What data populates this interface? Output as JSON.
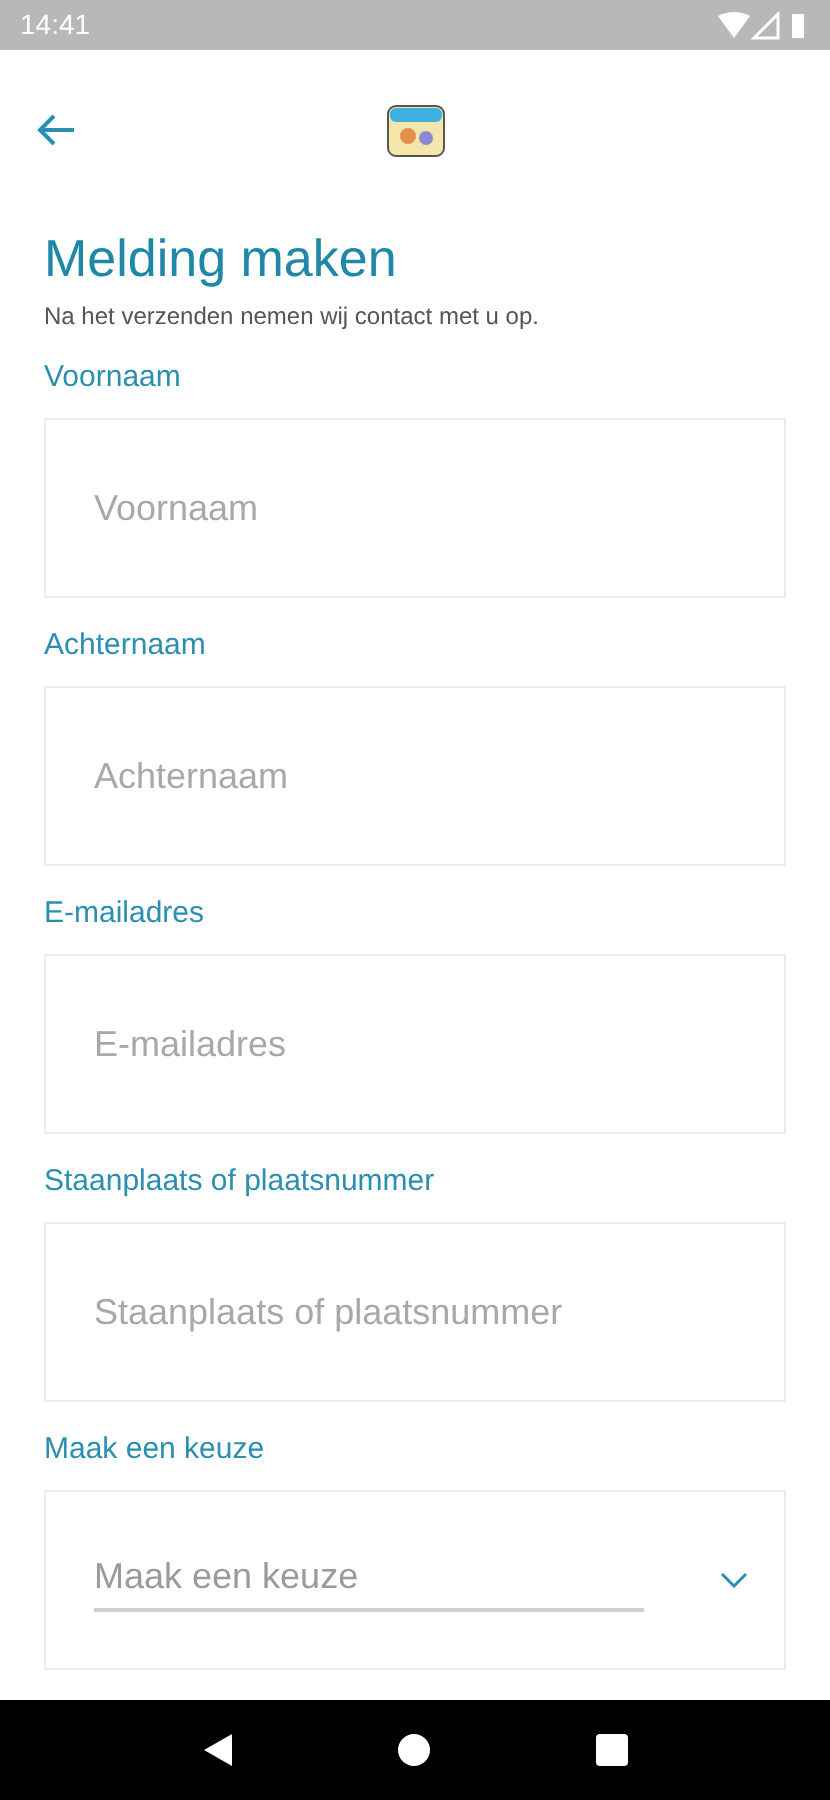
{
  "status_bar": {
    "time": "14:41"
  },
  "title": "Melding maken",
  "subtitle": "Na het verzenden nemen wij contact met u op.",
  "fields": [
    {
      "kind": "text",
      "label": "Voornaam",
      "placeholder": "Voornaam"
    },
    {
      "kind": "text",
      "label": "Achternaam",
      "placeholder": "Achternaam"
    },
    {
      "kind": "text",
      "label": "E-mailadres",
      "placeholder": "E-mailadres"
    },
    {
      "kind": "text",
      "label": "Staanplaats of plaatsnummer",
      "placeholder": "Staanplaats of plaatsnummer"
    },
    {
      "kind": "select",
      "label": "Maak een keuze",
      "placeholder": "Maak een keuze"
    }
  ]
}
